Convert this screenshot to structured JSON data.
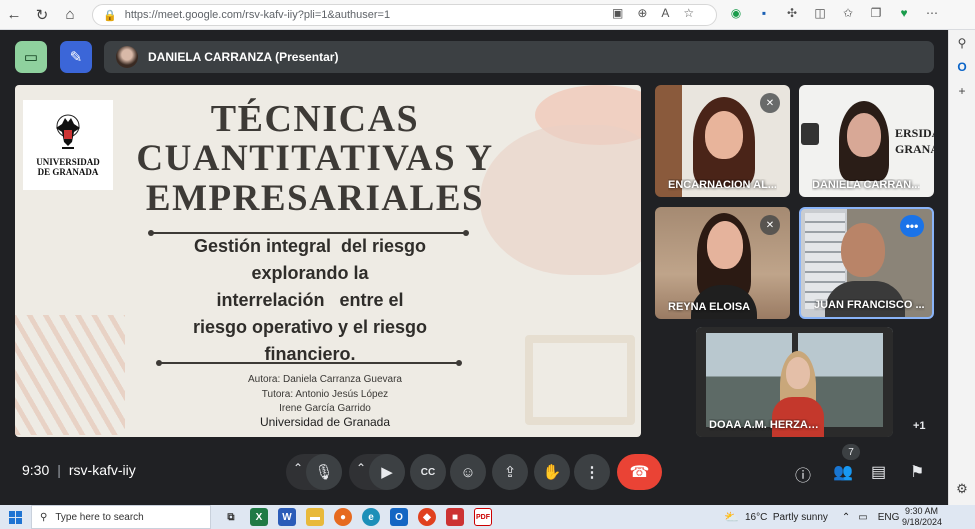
{
  "browser": {
    "url": "https://meet.google.com/rsv-kafv-iiy?pli=1&authuser=1"
  },
  "presenter": {
    "label": "DANIELA CARRANZA (Presentar)"
  },
  "slide": {
    "logo_line1": "UNIVERSIDAD",
    "logo_line2": "DE GRANADA",
    "title_line1": "TÉCNICAS",
    "title_line2": "CUANTITATIVAS Y",
    "title_line3": "EMPRESARIALES",
    "subtitle_line1": "Gestión integral  del riesgo",
    "subtitle_line2": "explorando la",
    "subtitle_line3": "interrelación   entre el",
    "subtitle_line4": "riesgo operativo y el riesgo",
    "subtitle_line5": "financiero.",
    "author": "Autora: Daniela Carranza Guevara",
    "tutor": "Tutora: Antonio Jesús López",
    "cotutor": "Irene García Garrido",
    "university": "Universidad de Granada"
  },
  "participants": [
    {
      "name": "ENCARNACION AL...",
      "muted": true
    },
    {
      "name": "DANIELA CARRAN...",
      "muted": false
    },
    {
      "name": "REYNA ELOISA",
      "muted": true
    },
    {
      "name": "JUAN FRANCISCO ...",
      "muted": false
    },
    {
      "name": "DOAA A.M. HERZALLAH",
      "muted": false
    }
  ],
  "extra_participants": "+1",
  "controls": {
    "time": "9:30",
    "meeting_code": "rsv-kafv-iiy",
    "participant_count": "7"
  },
  "taskbar": {
    "search_placeholder": "Type here to search",
    "weather": "16°C  Partly sunny",
    "language": "ENG",
    "time": "9:30 AM",
    "date": "9/18/2024"
  },
  "colors": {
    "meet_bg": "#202124",
    "hangup": "#ea4335",
    "active_speaker": "#8ab4f8",
    "more_button": "#1a73e8"
  }
}
